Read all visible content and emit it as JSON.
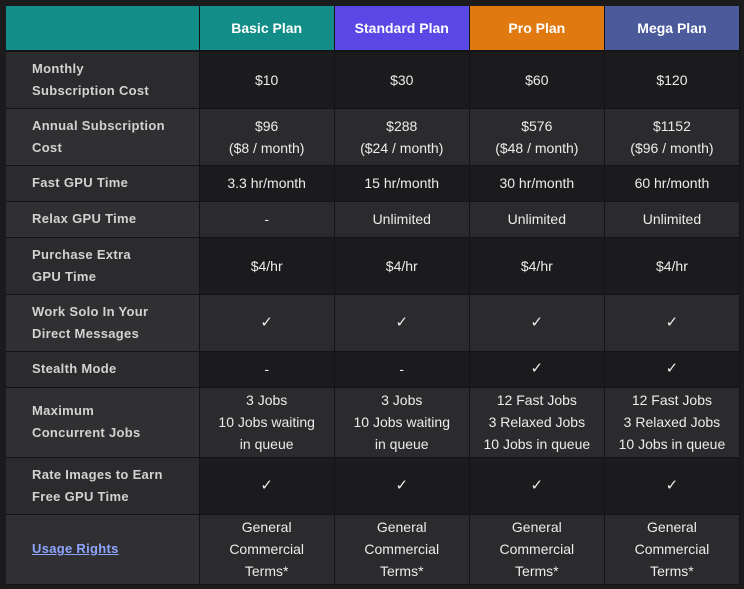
{
  "colors": {
    "corner": "#138d87",
    "basic": "#138d87",
    "standard": "#5a48e6",
    "pro": "#e07a10",
    "mega": "#4a5a9a",
    "link": "#8fa4ff",
    "row_dark": "#1b1b1d",
    "row_light": "#2b2b2d"
  },
  "plans": [
    {
      "name": "Basic Plan",
      "color": "#138d87"
    },
    {
      "name": "Standard Plan",
      "color": "#5a48e6"
    },
    {
      "name": "Pro Plan",
      "color": "#e07a10"
    },
    {
      "name": "Mega Plan",
      "color": "#4a5a9a"
    }
  ],
  "rows": [
    {
      "feature": [
        "Monthly",
        "Subscription Cost"
      ],
      "height": 57,
      "values": [
        [
          "$10"
        ],
        [
          "$30"
        ],
        [
          "$60"
        ],
        [
          "$120"
        ]
      ]
    },
    {
      "feature": [
        "Annual Subscription",
        "Cost"
      ],
      "height": 57,
      "values": [
        [
          "$96",
          "($8 / month)"
        ],
        [
          "$288",
          "($24 / month)"
        ],
        [
          "$576",
          "($48 / month)"
        ],
        [
          "$1152",
          "($96 / month)"
        ]
      ]
    },
    {
      "feature": [
        "Fast GPU Time"
      ],
      "height": 36,
      "values": [
        [
          "3.3 hr/month"
        ],
        [
          "15 hr/month"
        ],
        [
          "30 hr/month"
        ],
        [
          "60 hr/month"
        ]
      ]
    },
    {
      "feature": [
        "Relax GPU Time"
      ],
      "height": 36,
      "values": [
        [
          "-"
        ],
        [
          "Unlimited"
        ],
        [
          "Unlimited"
        ],
        [
          "Unlimited"
        ]
      ]
    },
    {
      "feature": [
        "Purchase Extra",
        "GPU Time"
      ],
      "height": 57,
      "values": [
        [
          "$4/hr"
        ],
        [
          "$4/hr"
        ],
        [
          "$4/hr"
        ],
        [
          "$4/hr"
        ]
      ]
    },
    {
      "feature": [
        "Work Solo In Your",
        "Direct Messages"
      ],
      "height": 57,
      "values": [
        [
          "✓"
        ],
        [
          "✓"
        ],
        [
          "✓"
        ],
        [
          "✓"
        ]
      ]
    },
    {
      "feature": [
        "Stealth Mode"
      ],
      "height": 36,
      "values": [
        [
          "-"
        ],
        [
          "-"
        ],
        [
          "✓"
        ],
        [
          "✓"
        ]
      ]
    },
    {
      "feature": [
        "Maximum",
        "Concurrent Jobs"
      ],
      "height": 70,
      "values": [
        [
          "3 Jobs",
          "10 Jobs waiting",
          "in queue"
        ],
        [
          "3 Jobs",
          "10 Jobs waiting",
          "in queue"
        ],
        [
          "12 Fast Jobs",
          "3 Relaxed Jobs",
          "10 Jobs in queue"
        ],
        [
          "12 Fast Jobs",
          "3 Relaxed Jobs",
          "10 Jobs in queue"
        ]
      ]
    },
    {
      "feature": [
        "Rate Images to Earn",
        "Free GPU Time"
      ],
      "height": 57,
      "values": [
        [
          "✓"
        ],
        [
          "✓"
        ],
        [
          "✓"
        ],
        [
          "✓"
        ]
      ]
    },
    {
      "feature": [
        "Usage Rights"
      ],
      "link": true,
      "height": 70,
      "values": [
        [
          "General",
          "Commercial",
          "Terms*"
        ],
        [
          "General",
          "Commercial",
          "Terms*"
        ],
        [
          "General",
          "Commercial",
          "Terms*"
        ],
        [
          "General",
          "Commercial",
          "Terms*"
        ]
      ]
    }
  ]
}
